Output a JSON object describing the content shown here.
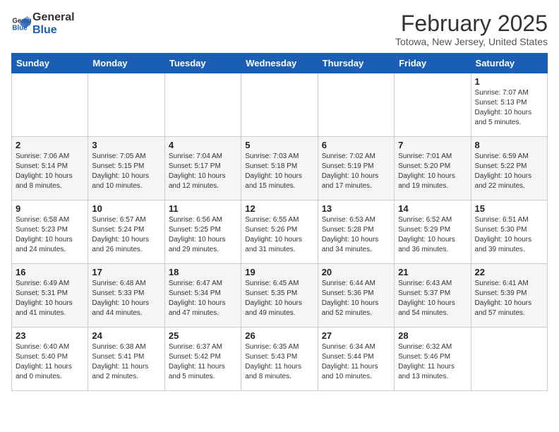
{
  "logo": {
    "line1": "General",
    "line2": "Blue"
  },
  "title": "February 2025",
  "subtitle": "Totowa, New Jersey, United States",
  "days_of_week": [
    "Sunday",
    "Monday",
    "Tuesday",
    "Wednesday",
    "Thursday",
    "Friday",
    "Saturday"
  ],
  "weeks": [
    [
      {
        "day": "",
        "info": ""
      },
      {
        "day": "",
        "info": ""
      },
      {
        "day": "",
        "info": ""
      },
      {
        "day": "",
        "info": ""
      },
      {
        "day": "",
        "info": ""
      },
      {
        "day": "",
        "info": ""
      },
      {
        "day": "1",
        "info": "Sunrise: 7:07 AM\nSunset: 5:13 PM\nDaylight: 10 hours\nand 5 minutes."
      }
    ],
    [
      {
        "day": "2",
        "info": "Sunrise: 7:06 AM\nSunset: 5:14 PM\nDaylight: 10 hours\nand 8 minutes."
      },
      {
        "day": "3",
        "info": "Sunrise: 7:05 AM\nSunset: 5:15 PM\nDaylight: 10 hours\nand 10 minutes."
      },
      {
        "day": "4",
        "info": "Sunrise: 7:04 AM\nSunset: 5:17 PM\nDaylight: 10 hours\nand 12 minutes."
      },
      {
        "day": "5",
        "info": "Sunrise: 7:03 AM\nSunset: 5:18 PM\nDaylight: 10 hours\nand 15 minutes."
      },
      {
        "day": "6",
        "info": "Sunrise: 7:02 AM\nSunset: 5:19 PM\nDaylight: 10 hours\nand 17 minutes."
      },
      {
        "day": "7",
        "info": "Sunrise: 7:01 AM\nSunset: 5:20 PM\nDaylight: 10 hours\nand 19 minutes."
      },
      {
        "day": "8",
        "info": "Sunrise: 6:59 AM\nSunset: 5:22 PM\nDaylight: 10 hours\nand 22 minutes."
      }
    ],
    [
      {
        "day": "9",
        "info": "Sunrise: 6:58 AM\nSunset: 5:23 PM\nDaylight: 10 hours\nand 24 minutes."
      },
      {
        "day": "10",
        "info": "Sunrise: 6:57 AM\nSunset: 5:24 PM\nDaylight: 10 hours\nand 26 minutes."
      },
      {
        "day": "11",
        "info": "Sunrise: 6:56 AM\nSunset: 5:25 PM\nDaylight: 10 hours\nand 29 minutes."
      },
      {
        "day": "12",
        "info": "Sunrise: 6:55 AM\nSunset: 5:26 PM\nDaylight: 10 hours\nand 31 minutes."
      },
      {
        "day": "13",
        "info": "Sunrise: 6:53 AM\nSunset: 5:28 PM\nDaylight: 10 hours\nand 34 minutes."
      },
      {
        "day": "14",
        "info": "Sunrise: 6:52 AM\nSunset: 5:29 PM\nDaylight: 10 hours\nand 36 minutes."
      },
      {
        "day": "15",
        "info": "Sunrise: 6:51 AM\nSunset: 5:30 PM\nDaylight: 10 hours\nand 39 minutes."
      }
    ],
    [
      {
        "day": "16",
        "info": "Sunrise: 6:49 AM\nSunset: 5:31 PM\nDaylight: 10 hours\nand 41 minutes."
      },
      {
        "day": "17",
        "info": "Sunrise: 6:48 AM\nSunset: 5:33 PM\nDaylight: 10 hours\nand 44 minutes."
      },
      {
        "day": "18",
        "info": "Sunrise: 6:47 AM\nSunset: 5:34 PM\nDaylight: 10 hours\nand 47 minutes."
      },
      {
        "day": "19",
        "info": "Sunrise: 6:45 AM\nSunset: 5:35 PM\nDaylight: 10 hours\nand 49 minutes."
      },
      {
        "day": "20",
        "info": "Sunrise: 6:44 AM\nSunset: 5:36 PM\nDaylight: 10 hours\nand 52 minutes."
      },
      {
        "day": "21",
        "info": "Sunrise: 6:43 AM\nSunset: 5:37 PM\nDaylight: 10 hours\nand 54 minutes."
      },
      {
        "day": "22",
        "info": "Sunrise: 6:41 AM\nSunset: 5:39 PM\nDaylight: 10 hours\nand 57 minutes."
      }
    ],
    [
      {
        "day": "23",
        "info": "Sunrise: 6:40 AM\nSunset: 5:40 PM\nDaylight: 11 hours\nand 0 minutes."
      },
      {
        "day": "24",
        "info": "Sunrise: 6:38 AM\nSunset: 5:41 PM\nDaylight: 11 hours\nand 2 minutes."
      },
      {
        "day": "25",
        "info": "Sunrise: 6:37 AM\nSunset: 5:42 PM\nDaylight: 11 hours\nand 5 minutes."
      },
      {
        "day": "26",
        "info": "Sunrise: 6:35 AM\nSunset: 5:43 PM\nDaylight: 11 hours\nand 8 minutes."
      },
      {
        "day": "27",
        "info": "Sunrise: 6:34 AM\nSunset: 5:44 PM\nDaylight: 11 hours\nand 10 minutes."
      },
      {
        "day": "28",
        "info": "Sunrise: 6:32 AM\nSunset: 5:46 PM\nDaylight: 11 hours\nand 13 minutes."
      },
      {
        "day": "",
        "info": ""
      }
    ]
  ]
}
